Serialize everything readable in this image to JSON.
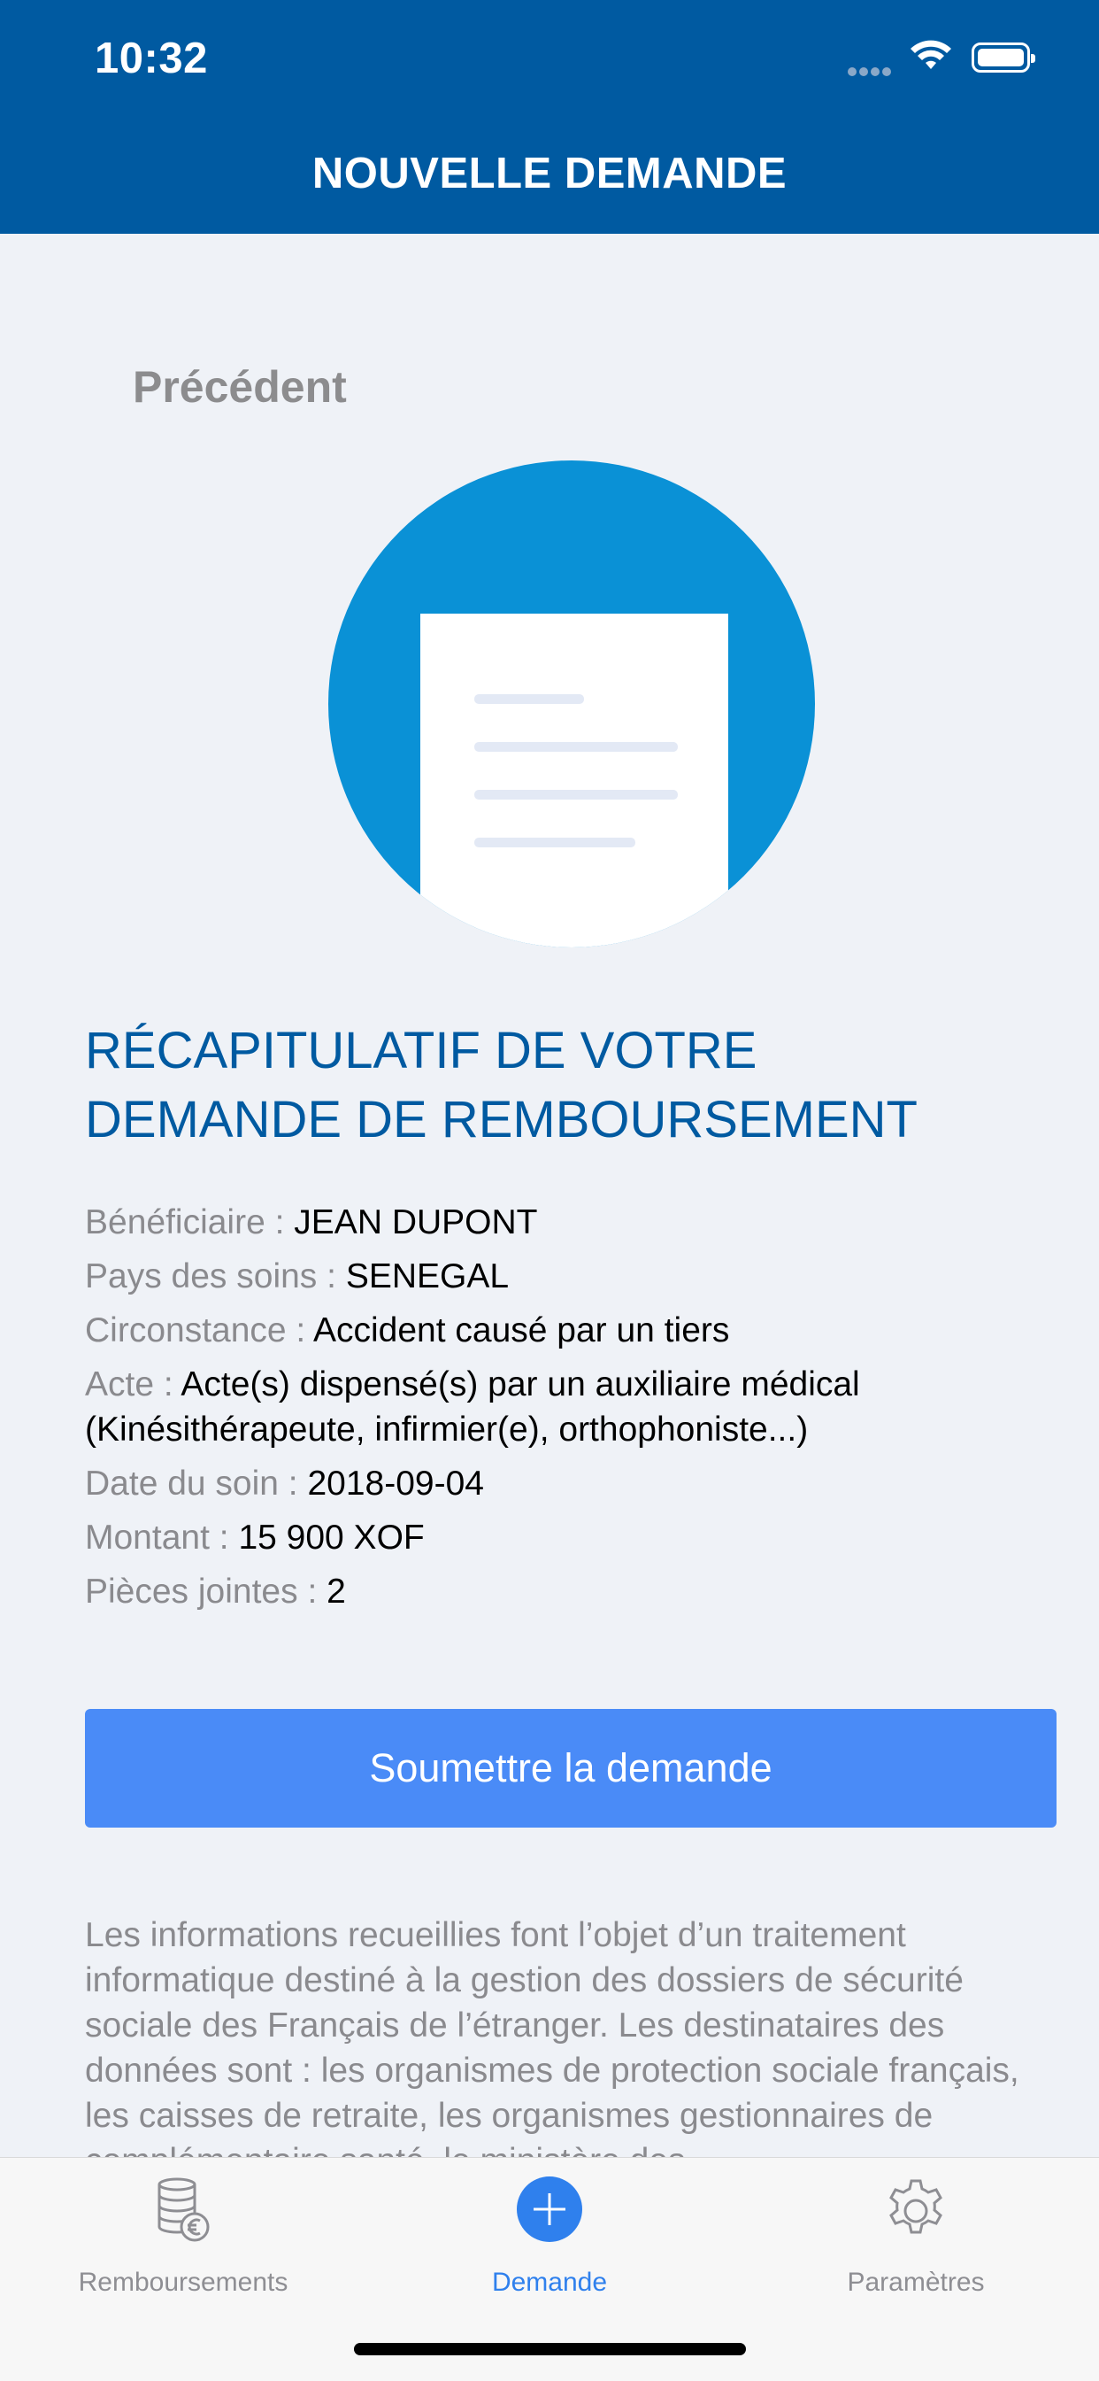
{
  "status": {
    "time": "10:32"
  },
  "header": {
    "title": "NOUVELLE DEMANDE"
  },
  "nav": {
    "back_label": "Précédent"
  },
  "icons": {
    "document_illustration": "document-icon",
    "tab_remboursements": "coins-euro-icon",
    "tab_demande": "plus-circle-icon",
    "tab_parametres": "gear-icon"
  },
  "recap": {
    "title_line1": "RÉCAPITULATIF DE VOTRE",
    "title_line2": "DEMANDE DE REMBOURSEMENT",
    "rows": [
      {
        "label": "Bénéficiaire : ",
        "value": "JEAN DUPONT"
      },
      {
        "label": "Pays des soins : ",
        "value": "SENEGAL"
      },
      {
        "label": "Circonstance : ",
        "value": "Accident causé par un tiers"
      },
      {
        "label": "Acte : ",
        "value": "Acte(s) dispensé(s) par un auxiliaire médical (Kinésithérapeute, infirmier(e), orthophoniste...)"
      },
      {
        "label": "Date du soin : ",
        "value": "2018-09-04"
      },
      {
        "label": "Montant : ",
        "value": "15 900 XOF"
      },
      {
        "label": "Pièces jointes : ",
        "value": "2"
      }
    ]
  },
  "actions": {
    "submit_label": "Soumettre la demande"
  },
  "legal": {
    "text": "Les informations recueillies font l’objet d’un traitement informatique destiné à la gestion des dossiers de sécurité sociale des Français de l’étranger. Les destinataires des données sont : les organismes de protection sociale français, les caisses de retraite, les organismes gestionnaires de complémentaire santé, le ministère des"
  },
  "tabbar": {
    "items": [
      {
        "label": "Remboursements"
      },
      {
        "label": "Demande"
      },
      {
        "label": "Paramètres"
      }
    ]
  },
  "colors": {
    "header": "#005aa1",
    "accent": "#4a8bf7",
    "tab_active": "#2f80ed",
    "illustration": "#0a91d6"
  }
}
